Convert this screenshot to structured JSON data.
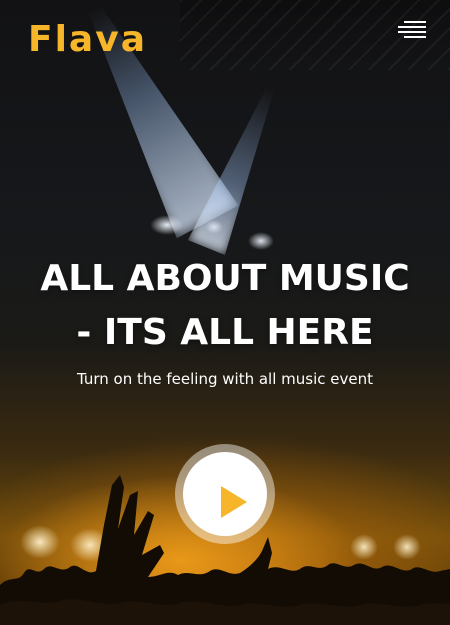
{
  "header": {
    "logo_text": "Flava",
    "menu_icon": "hamburger-menu-icon"
  },
  "hero": {
    "headline_line1": "ALL ABOUT MUSIC",
    "headline_line2": "- ITS ALL HERE",
    "subtitle": "Turn on the feeling with all music event",
    "play_icon": "play-icon"
  },
  "colors": {
    "accent": "#f7b62a",
    "text": "#ffffff"
  }
}
